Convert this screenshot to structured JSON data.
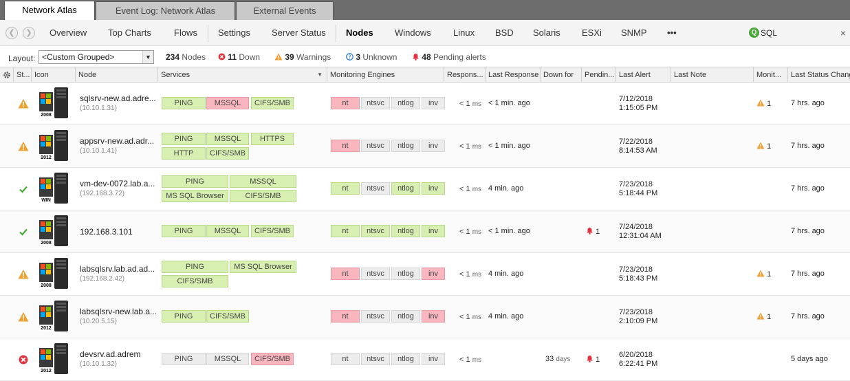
{
  "tabs": [
    "Network Atlas",
    "Event Log: Network Atlas",
    "External Events"
  ],
  "nav": {
    "back_icon": "arrow-left-icon",
    "forward_icon": "arrow-right-icon",
    "items": [
      "Overview",
      "Top Charts",
      "Flows",
      "Settings",
      "Server Status",
      "Nodes",
      "Windows",
      "Linux",
      "BSD",
      "Solaris",
      "ESXi",
      "SNMP"
    ],
    "more": "•••",
    "active": "Nodes"
  },
  "search": {
    "value": "SQL",
    "clear": "×",
    "icon": "search-icon"
  },
  "layout": {
    "label": "Layout:",
    "value": "<Custom Grouped>"
  },
  "stats": {
    "nodes_count": "234",
    "nodes_label": "Nodes",
    "down_count": "11",
    "down_label": "Down",
    "warnings_count": "39",
    "warnings_label": "Warnings",
    "unknown_count": "3",
    "unknown_label": "Unknown",
    "alerts_count": "48",
    "alerts_label": "Pending alerts"
  },
  "columns": [
    "St...",
    "Icon",
    "Node",
    "Services",
    "Monitoring Engines",
    "Respons...",
    "Last Response",
    "Down for",
    "Pendin...",
    "Last Alert",
    "Last Note",
    "Monit...",
    "Last Status Change"
  ],
  "colors": {
    "ok": "#d7f0b1",
    "error": "#f9b6bf",
    "neutral": "#ececec",
    "warning": "#f0a030",
    "down": "#e0333f",
    "accent": "#4aa83a"
  },
  "rows": [
    {
      "status": "warning",
      "os": "2008",
      "node": "sqlsrv-new.ad.adre...",
      "ip": "(10.10.1.31)",
      "services": [
        {
          "name": "PING",
          "state": "ok"
        },
        {
          "name": "MSSQL",
          "state": "err"
        },
        {
          "name": "CIFS/SMB",
          "state": "ok"
        }
      ],
      "engines": [
        {
          "name": "nt",
          "state": "err"
        },
        {
          "name": "ntsvc",
          "state": "gry"
        },
        {
          "name": "ntlog",
          "state": "gry"
        },
        {
          "name": "inv",
          "state": "gry"
        }
      ],
      "response_lt": "<",
      "response_val": "1",
      "response_unit": "ms",
      "last_response": "< 1 min. ago",
      "down_for": "",
      "down_unit": "",
      "pending": "",
      "alert_date": "7/12/2018",
      "alert_time": "1:15:05 PM",
      "monitors": "1",
      "last_status_change": "7 hrs. ago"
    },
    {
      "status": "warning",
      "os": "2012",
      "node": "appsrv-new.ad.adr...",
      "ip": "(10.10.1.41)",
      "services": [
        {
          "name": "PING",
          "state": "ok"
        },
        {
          "name": "MSSQL",
          "state": "ok"
        },
        {
          "name": "HTTPS",
          "state": "ok"
        },
        {
          "name": "HTTP",
          "state": "ok"
        },
        {
          "name": "CIFS/SMB",
          "state": "ok"
        }
      ],
      "engines": [
        {
          "name": "nt",
          "state": "err"
        },
        {
          "name": "ntsvc",
          "state": "gry"
        },
        {
          "name": "ntlog",
          "state": "gry"
        },
        {
          "name": "inv",
          "state": "gry"
        }
      ],
      "response_lt": "<",
      "response_val": "1",
      "response_unit": "ms",
      "last_response": "< 1 min. ago",
      "down_for": "",
      "down_unit": "",
      "pending": "",
      "alert_date": "7/22/2018",
      "alert_time": "8:14:53 AM",
      "monitors": "1",
      "last_status_change": "7 hrs. ago"
    },
    {
      "status": "ok",
      "os": "WIN",
      "node": "vm-dev-0072.lab.a...",
      "ip": "(192.168.3.72)",
      "services": [
        {
          "name": "PING",
          "state": "ok"
        },
        {
          "name": "MSSQL",
          "state": "ok"
        },
        {
          "name": "MS SQL Browser",
          "state": "ok"
        },
        {
          "name": "CIFS/SMB",
          "state": "ok"
        }
      ],
      "engines": [
        {
          "name": "nt",
          "state": "ok"
        },
        {
          "name": "ntsvc",
          "state": "gry"
        },
        {
          "name": "ntlog",
          "state": "ok"
        },
        {
          "name": "inv",
          "state": "ok"
        }
      ],
      "response_lt": "<",
      "response_val": "1",
      "response_unit": "ms",
      "last_response": "4 min. ago",
      "down_for": "",
      "down_unit": "",
      "pending": "",
      "alert_date": "7/23/2018",
      "alert_time": "5:18:44 PM",
      "monitors": "",
      "last_status_change": "7 hrs. ago"
    },
    {
      "status": "ok",
      "os": "2008",
      "node": "192.168.3.101",
      "ip": "",
      "services": [
        {
          "name": "PING",
          "state": "ok"
        },
        {
          "name": "MSSQL",
          "state": "ok"
        },
        {
          "name": "CIFS/SMB",
          "state": "ok"
        }
      ],
      "engines": [
        {
          "name": "nt",
          "state": "ok"
        },
        {
          "name": "ntsvc",
          "state": "ok"
        },
        {
          "name": "ntlog",
          "state": "ok"
        },
        {
          "name": "inv",
          "state": "ok"
        }
      ],
      "response_lt": "<",
      "response_val": "1",
      "response_unit": "ms",
      "last_response": "< 1 min. ago",
      "down_for": "",
      "down_unit": "",
      "pending": "1",
      "alert_date": "7/24/2018",
      "alert_time": "12:31:04 AM",
      "monitors": "",
      "last_status_change": "7 hrs. ago"
    },
    {
      "status": "warning",
      "os": "2008",
      "node": "labsqlsrv.lab.ad.ad...",
      "ip": "(192.168.2.42)",
      "services": [
        {
          "name": "PING",
          "state": "ok"
        },
        {
          "name": "MS SQL Browser",
          "state": "ok"
        },
        {
          "name": "CIFS/SMB",
          "state": "ok"
        }
      ],
      "engines": [
        {
          "name": "nt",
          "state": "err"
        },
        {
          "name": "ntsvc",
          "state": "gry"
        },
        {
          "name": "ntlog",
          "state": "gry"
        },
        {
          "name": "inv",
          "state": "err"
        }
      ],
      "response_lt": "<",
      "response_val": "1",
      "response_unit": "ms",
      "last_response": "4 min. ago",
      "down_for": "",
      "down_unit": "",
      "pending": "",
      "alert_date": "7/23/2018",
      "alert_time": "5:18:43 PM",
      "monitors": "1",
      "last_status_change": "7 hrs. ago"
    },
    {
      "status": "warning",
      "os": "2012",
      "node": "labsqlsrv-new.lab.a...",
      "ip": "(10.20.5.15)",
      "services": [
        {
          "name": "PING",
          "state": "ok"
        },
        {
          "name": "CIFS/SMB",
          "state": "ok"
        }
      ],
      "engines": [
        {
          "name": "nt",
          "state": "err"
        },
        {
          "name": "ntsvc",
          "state": "gry"
        },
        {
          "name": "ntlog",
          "state": "gry"
        },
        {
          "name": "inv",
          "state": "err"
        }
      ],
      "response_lt": "<",
      "response_val": "1",
      "response_unit": "ms",
      "last_response": "4 min. ago",
      "down_for": "",
      "down_unit": "",
      "pending": "",
      "alert_date": "7/23/2018",
      "alert_time": "2:10:09 PM",
      "monitors": "1",
      "last_status_change": "7 hrs. ago"
    },
    {
      "status": "down",
      "os": "2012",
      "node": "devsrv.ad.adrem",
      "ip": "(10.10.1.32)",
      "services": [
        {
          "name": "PING",
          "state": "gry"
        },
        {
          "name": "MSSQL",
          "state": "gry"
        },
        {
          "name": "CIFS/SMB",
          "state": "err"
        }
      ],
      "engines": [
        {
          "name": "nt",
          "state": "gry"
        },
        {
          "name": "ntsvc",
          "state": "gry"
        },
        {
          "name": "ntlog",
          "state": "gry"
        },
        {
          "name": "inv",
          "state": "gry"
        }
      ],
      "response_lt": "<",
      "response_val": "1",
      "response_unit": "ms",
      "last_response": "",
      "down_for": "33",
      "down_unit": "days",
      "pending": "1",
      "alert_date": "6/20/2018",
      "alert_time": "6:22:41 PM",
      "monitors": "",
      "last_status_change": "5 days ago"
    }
  ]
}
